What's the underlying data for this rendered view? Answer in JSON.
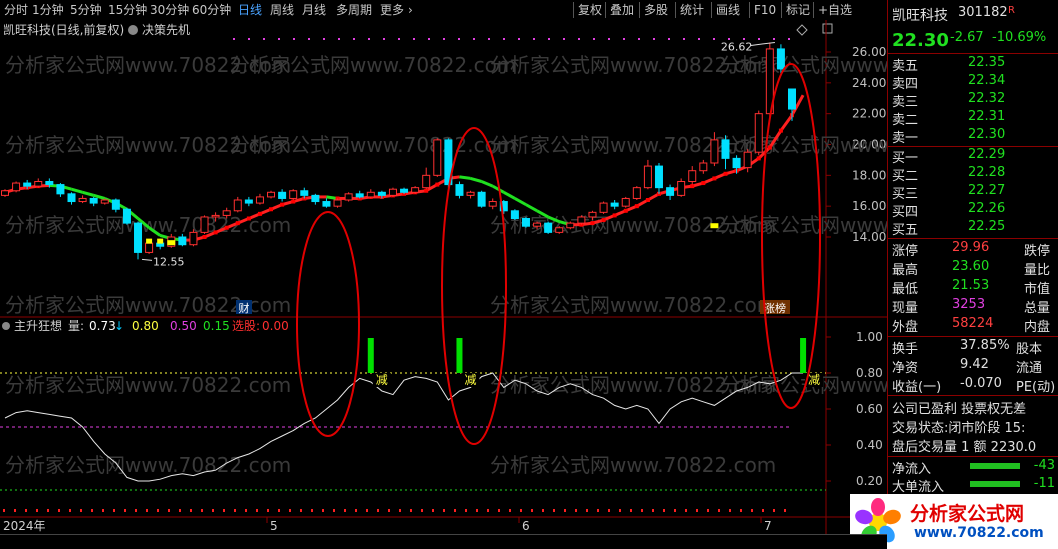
{
  "toolbar": {
    "periods": [
      "分时",
      "1分钟",
      "5分钟",
      "15分钟",
      "30分钟",
      "60分钟",
      "日线",
      "周线",
      "月线",
      "多周期",
      "更多"
    ],
    "active_period": "日线",
    "actions": [
      "复权",
      "叠加",
      "多股",
      "统计",
      "画线",
      "F10",
      "标记",
      "+自选"
    ]
  },
  "chart": {
    "title": "凯旺科技(日线,前复权)",
    "indicator_name": "决策先机",
    "price_ticks": [
      "26.00",
      "24.00",
      "22.00",
      "20.00",
      "18.00",
      "16.00",
      "14.00"
    ],
    "high_label": "26.62",
    "low_label": "12.55",
    "marker_cai": "财",
    "marker_zhang": "涨榜",
    "watermark": "分析家公式网www.70822.com"
  },
  "sub_chart": {
    "name": "主升狂想",
    "label_liang": "量:",
    "value_liang": "0.73",
    "value_080": "0.80",
    "value_050": "0.50",
    "value_015": "0.15",
    "label_xuangu": "选股:",
    "value_xuangu": "0.00",
    "ticks": [
      "1.00",
      "0.80",
      "0.60",
      "0.40",
      "0.20"
    ],
    "signal_label": "减",
    "line_values": [
      0.55,
      0.58,
      0.59,
      0.58,
      0.57,
      0.56,
      0.55,
      0.5,
      0.42,
      0.35,
      0.3,
      0.22,
      0.2,
      0.2,
      0.21,
      0.23,
      0.24,
      0.23,
      0.25,
      0.26,
      0.3,
      0.33,
      0.35,
      0.38,
      0.42,
      0.45,
      0.48,
      0.52,
      0.55,
      0.6,
      0.65,
      0.72,
      0.77,
      0.75,
      0.7,
      0.68,
      0.76,
      0.78,
      0.77,
      0.75,
      0.65,
      0.7,
      0.72,
      0.78,
      0.8,
      0.72,
      0.76,
      0.74,
      0.7,
      0.68,
      0.72,
      0.74,
      0.72,
      0.68,
      0.66,
      0.62,
      0.6,
      0.62,
      0.6,
      0.52,
      0.6,
      0.64,
      0.66,
      0.64,
      0.62,
      0.66,
      0.7,
      0.72,
      0.75,
      0.74,
      0.76,
      0.8,
      0.8
    ]
  },
  "time_axis": [
    "2024年",
    "5",
    "6",
    "7"
  ],
  "quote": {
    "name": "凯旺科技",
    "code": "301182",
    "flag": "R",
    "price": "22.30",
    "change": "-2.67",
    "change_pct": "-10.69%",
    "asks": [
      {
        "label": "卖五",
        "price": "22.35"
      },
      {
        "label": "卖四",
        "price": "22.34"
      },
      {
        "label": "卖三",
        "price": "22.32"
      },
      {
        "label": "卖二",
        "price": "22.31"
      },
      {
        "label": "卖一",
        "price": "22.30"
      }
    ],
    "bids": [
      {
        "label": "买一",
        "price": "22.29"
      },
      {
        "label": "买二",
        "price": "22.28"
      },
      {
        "label": "买三",
        "price": "22.27"
      },
      {
        "label": "买四",
        "price": "22.26"
      },
      {
        "label": "买五",
        "price": "22.25"
      }
    ],
    "zhangting_label": "涨停",
    "zhangting": "29.96",
    "dieting_label": "跌停",
    "zuigao_label": "最高",
    "zuigao": "23.60",
    "liangbi_label": "量比",
    "zuidi_label": "最低",
    "zuidi": "21.53",
    "shizhi_label": "市值",
    "xianliang_label": "现量",
    "xianliang": "3253",
    "zongliang_label": "总量",
    "waipan_label": "外盘",
    "waipan": "58224",
    "neipan_label": "内盘",
    "huanshou_label": "换手",
    "huanshou": "37.85%",
    "guben_label": "股本",
    "jingzi_label": "净资",
    "jingzi": "9.42",
    "liutong_label": "流通",
    "shouyi_label": "收益(一)",
    "shouyi": "-0.070",
    "pe_label": "PE(动)",
    "info1": "公司已盈利 投票权无差",
    "info2": "交易状态:闭市阶段 15:",
    "info3": "盘后交易量 1 额 2230.0",
    "jingliuru_label": "净流入",
    "jingliuru": "-43",
    "dadan_label": "大单流入",
    "dadan": "-11"
  },
  "logo": {
    "text": "分析家公式网",
    "url": "www.70822.com"
  },
  "colors": {
    "up": "#ff3030",
    "down": "#00e0ff",
    "ma_up": "#ff2020",
    "ma_down": "#20e020",
    "circle": "#e00000",
    "signal": "#00e000"
  },
  "candles": [
    {
      "o": 16.7,
      "c": 17.0,
      "h": 17.1,
      "l": 16.6
    },
    {
      "o": 17.0,
      "c": 17.5,
      "h": 17.6,
      "l": 16.9
    },
    {
      "o": 17.5,
      "c": 17.3,
      "h": 17.7,
      "l": 17.1
    },
    {
      "o": 17.3,
      "c": 17.6,
      "h": 17.8,
      "l": 17.2
    },
    {
      "o": 17.6,
      "c": 17.4,
      "h": 17.8,
      "l": 17.2
    },
    {
      "o": 17.4,
      "c": 16.8,
      "h": 17.5,
      "l": 16.6
    },
    {
      "o": 16.8,
      "c": 16.3,
      "h": 16.9,
      "l": 16.1
    },
    {
      "o": 16.3,
      "c": 16.5,
      "h": 16.7,
      "l": 16.2
    },
    {
      "o": 16.5,
      "c": 16.2,
      "h": 16.6,
      "l": 16.0
    },
    {
      "o": 16.2,
      "c": 16.4,
      "h": 16.5,
      "l": 16.1
    },
    {
      "o": 16.4,
      "c": 15.8,
      "h": 16.5,
      "l": 15.6
    },
    {
      "o": 15.8,
      "c": 14.9,
      "h": 15.9,
      "l": 14.8
    },
    {
      "o": 14.9,
      "c": 13.0,
      "h": 15.0,
      "l": 12.55
    },
    {
      "o": 13.0,
      "c": 13.6,
      "h": 13.8,
      "l": 12.9
    },
    {
      "o": 13.6,
      "c": 13.4,
      "h": 13.9,
      "l": 13.2
    },
    {
      "o": 13.4,
      "c": 14.0,
      "h": 14.2,
      "l": 13.3
    },
    {
      "o": 14.0,
      "c": 13.5,
      "h": 14.2,
      "l": 13.4
    },
    {
      "o": 13.5,
      "c": 14.3,
      "h": 14.5,
      "l": 13.4
    },
    {
      "o": 14.3,
      "c": 15.3,
      "h": 15.4,
      "l": 14.2
    },
    {
      "o": 15.3,
      "c": 15.4,
      "h": 15.6,
      "l": 15.0
    },
    {
      "o": 15.4,
      "c": 15.7,
      "h": 15.9,
      "l": 15.2
    },
    {
      "o": 15.7,
      "c": 16.4,
      "h": 16.6,
      "l": 15.6
    },
    {
      "o": 16.4,
      "c": 16.2,
      "h": 16.6,
      "l": 16.0
    },
    {
      "o": 16.2,
      "c": 16.6,
      "h": 16.8,
      "l": 16.1
    },
    {
      "o": 16.6,
      "c": 16.9,
      "h": 17.0,
      "l": 16.5
    },
    {
      "o": 16.9,
      "c": 16.5,
      "h": 17.1,
      "l": 16.3
    },
    {
      "o": 16.5,
      "c": 17.0,
      "h": 17.1,
      "l": 16.4
    },
    {
      "o": 17.0,
      "c": 16.7,
      "h": 17.2,
      "l": 16.5
    },
    {
      "o": 16.7,
      "c": 16.3,
      "h": 16.8,
      "l": 16.1
    },
    {
      "o": 16.3,
      "c": 16.0,
      "h": 16.5,
      "l": 15.9
    },
    {
      "o": 16.0,
      "c": 16.4,
      "h": 16.5,
      "l": 15.9
    },
    {
      "o": 16.4,
      "c": 16.8,
      "h": 16.9,
      "l": 16.3
    },
    {
      "o": 16.8,
      "c": 16.6,
      "h": 17.0,
      "l": 16.5
    },
    {
      "o": 16.6,
      "c": 16.9,
      "h": 17.1,
      "l": 16.5
    },
    {
      "o": 16.9,
      "c": 16.7,
      "h": 17.0,
      "l": 16.5
    },
    {
      "o": 16.7,
      "c": 17.1,
      "h": 17.2,
      "l": 16.6
    },
    {
      "o": 17.1,
      "c": 16.9,
      "h": 17.2,
      "l": 16.8
    },
    {
      "o": 16.9,
      "c": 17.2,
      "h": 17.3,
      "l": 16.8
    },
    {
      "o": 17.2,
      "c": 18.0,
      "h": 18.5,
      "l": 17.1
    },
    {
      "o": 18.0,
      "c": 20.3,
      "h": 20.4,
      "l": 17.9
    },
    {
      "o": 20.3,
      "c": 17.4,
      "h": 20.4,
      "l": 17.2
    },
    {
      "o": 17.4,
      "c": 16.7,
      "h": 17.6,
      "l": 16.5
    },
    {
      "o": 16.7,
      "c": 16.9,
      "h": 17.0,
      "l": 16.5
    },
    {
      "o": 16.9,
      "c": 16.0,
      "h": 17.0,
      "l": 15.9
    },
    {
      "o": 16.0,
      "c": 16.3,
      "h": 16.5,
      "l": 15.8
    },
    {
      "o": 16.3,
      "c": 15.7,
      "h": 16.4,
      "l": 15.5
    },
    {
      "o": 15.7,
      "c": 15.2,
      "h": 15.8,
      "l": 15.1
    },
    {
      "o": 15.2,
      "c": 14.7,
      "h": 15.3,
      "l": 14.6
    },
    {
      "o": 14.7,
      "c": 14.9,
      "h": 15.0,
      "l": 14.5
    },
    {
      "o": 14.9,
      "c": 14.3,
      "h": 15.0,
      "l": 14.2
    },
    {
      "o": 14.3,
      "c": 14.6,
      "h": 14.7,
      "l": 14.2
    },
    {
      "o": 14.6,
      "c": 14.9,
      "h": 15.0,
      "l": 14.5
    },
    {
      "o": 14.9,
      "c": 15.3,
      "h": 15.4,
      "l": 14.8
    },
    {
      "o": 15.3,
      "c": 15.6,
      "h": 15.7,
      "l": 15.1
    },
    {
      "o": 15.6,
      "c": 16.2,
      "h": 16.3,
      "l": 15.5
    },
    {
      "o": 16.2,
      "c": 16.0,
      "h": 16.4,
      "l": 15.8
    },
    {
      "o": 16.0,
      "c": 16.5,
      "h": 16.6,
      "l": 15.9
    },
    {
      "o": 16.5,
      "c": 17.2,
      "h": 17.3,
      "l": 16.4
    },
    {
      "o": 17.2,
      "c": 18.6,
      "h": 19.0,
      "l": 17.1
    },
    {
      "o": 18.6,
      "c": 17.2,
      "h": 18.8,
      "l": 16.8
    },
    {
      "o": 17.2,
      "c": 16.7,
      "h": 17.4,
      "l": 16.4
    },
    {
      "o": 16.7,
      "c": 17.6,
      "h": 17.8,
      "l": 16.6
    },
    {
      "o": 17.6,
      "c": 18.3,
      "h": 18.6,
      "l": 17.4
    },
    {
      "o": 18.3,
      "c": 18.8,
      "h": 19.0,
      "l": 18.1
    },
    {
      "o": 18.8,
      "c": 20.3,
      "h": 20.8,
      "l": 18.6
    },
    {
      "o": 20.3,
      "c": 19.1,
      "h": 20.6,
      "l": 18.4
    },
    {
      "o": 19.1,
      "c": 18.5,
      "h": 19.3,
      "l": 18.1
    },
    {
      "o": 18.5,
      "c": 19.5,
      "h": 19.7,
      "l": 18.2
    },
    {
      "o": 19.5,
      "c": 22.0,
      "h": 22.2,
      "l": 19.3
    },
    {
      "o": 22.0,
      "c": 26.2,
      "h": 26.62,
      "l": 21.8
    },
    {
      "o": 26.2,
      "c": 24.9,
      "h": 26.5,
      "l": 24.6
    },
    {
      "o": 23.6,
      "c": 22.3,
      "h": 23.6,
      "l": 21.53
    }
  ],
  "ma_values": [
    16.9,
    17.1,
    17.2,
    17.3,
    17.35,
    17.3,
    17.1,
    16.9,
    16.7,
    16.5,
    16.2,
    15.8,
    15.2,
    14.6,
    14.1,
    13.9,
    13.8,
    13.8,
    14.0,
    14.3,
    14.6,
    14.9,
    15.2,
    15.5,
    15.8,
    16.1,
    16.3,
    16.5,
    16.6,
    16.6,
    16.5,
    16.5,
    16.5,
    16.6,
    16.6,
    16.7,
    16.8,
    16.9,
    17.0,
    17.4,
    17.8,
    17.9,
    17.8,
    17.6,
    17.3,
    16.9,
    16.5,
    16.1,
    15.7,
    15.3,
    15.0,
    14.8,
    14.8,
    14.9,
    15.1,
    15.4,
    15.7,
    16.0,
    16.4,
    16.8,
    17.0,
    17.2,
    17.3,
    17.5,
    17.8,
    18.1,
    18.3,
    18.6,
    19.1,
    19.8,
    20.9,
    21.9,
    23.2
  ],
  "sub_signal_values": [
    {
      "idx": 33,
      "v": 0.2
    },
    {
      "idx": 41,
      "v": 0.2
    },
    {
      "idx": 72,
      "v": 0.2
    }
  ]
}
